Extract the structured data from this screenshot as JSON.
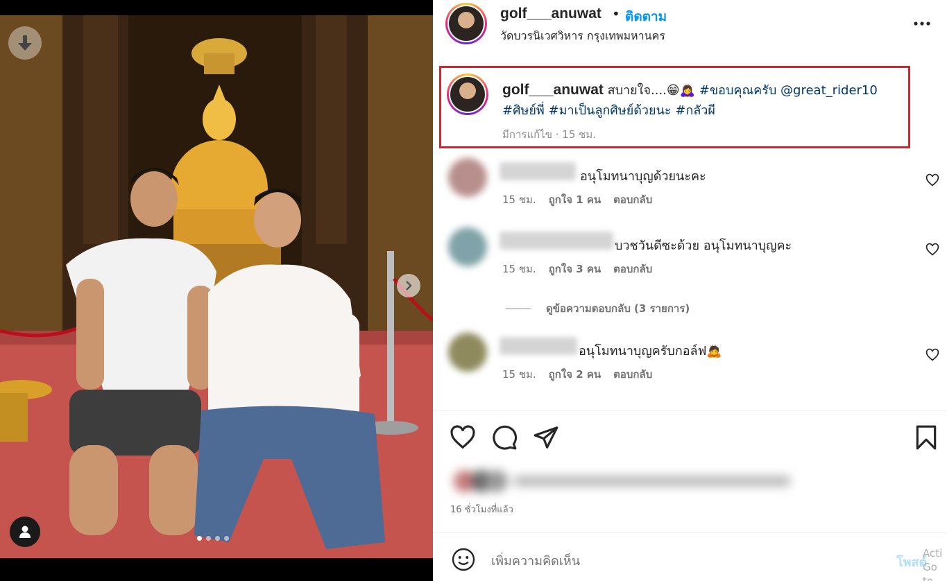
{
  "post": {
    "username": "golf___anuwat",
    "separator": "•",
    "follow_label": "ติดตาม",
    "location": "วัดบวรนิเวศวิหาร กรุงเทพมหานคร"
  },
  "caption": {
    "username": "golf___anuwat",
    "text_plain": " สบายใจ....😁🙇‍♀️ ",
    "tag_thanks": "#ขอบคุณครับ",
    "mention": "@great_rider10",
    "tag_student": "#ศิษย์พี่",
    "tag_become": "#มาเป็นลูกศิษย์ด้วยนะ",
    "tag_ghost": "#กลัวผี",
    "meta": "มีการแก้ไข · 15 ชม."
  },
  "comments": [
    {
      "text": "อนุโมทนาบุญด้วยนะคะ",
      "time": "15 ชม.",
      "likes": "ถูกใจ 1 คน",
      "reply": "ตอบกลับ"
    },
    {
      "text": "บวชวันดีซะด้วย อนุโมทนาบุญคะ",
      "time": "15 ชม.",
      "likes": "ถูกใจ 3 คน",
      "reply": "ตอบกลับ"
    },
    {
      "text": "อนุโมทนาบุญครับกอล์ฟ🙇",
      "time": "15 ชม.",
      "likes": "ถูกใจ 2 คน",
      "reply": "ตอบกลับ"
    }
  ],
  "view_replies_label": "ดูข้อความตอบกลับ (3 รายการ)",
  "post_time": "16 ชั่วโมงที่แล้ว",
  "add_comment": {
    "placeholder": "เพิ่มความคิดเห็น",
    "post_label": "โพสต์"
  },
  "watermark": "Acti Go to",
  "carousel": {
    "total": 4,
    "active_index": 0
  },
  "icons": {
    "download": "download-icon",
    "next": "chevron-right-icon",
    "user_tag": "user-icon",
    "more": "more-horizontal-icon",
    "heart": "heart-icon",
    "comment": "comment-icon",
    "share": "share-icon",
    "save": "bookmark-icon",
    "emoji": "emoji-icon"
  },
  "colors": {
    "accent": "#0095f6",
    "link": "#00376b",
    "highlight_border": "#d8232a",
    "muted": "#737373"
  }
}
